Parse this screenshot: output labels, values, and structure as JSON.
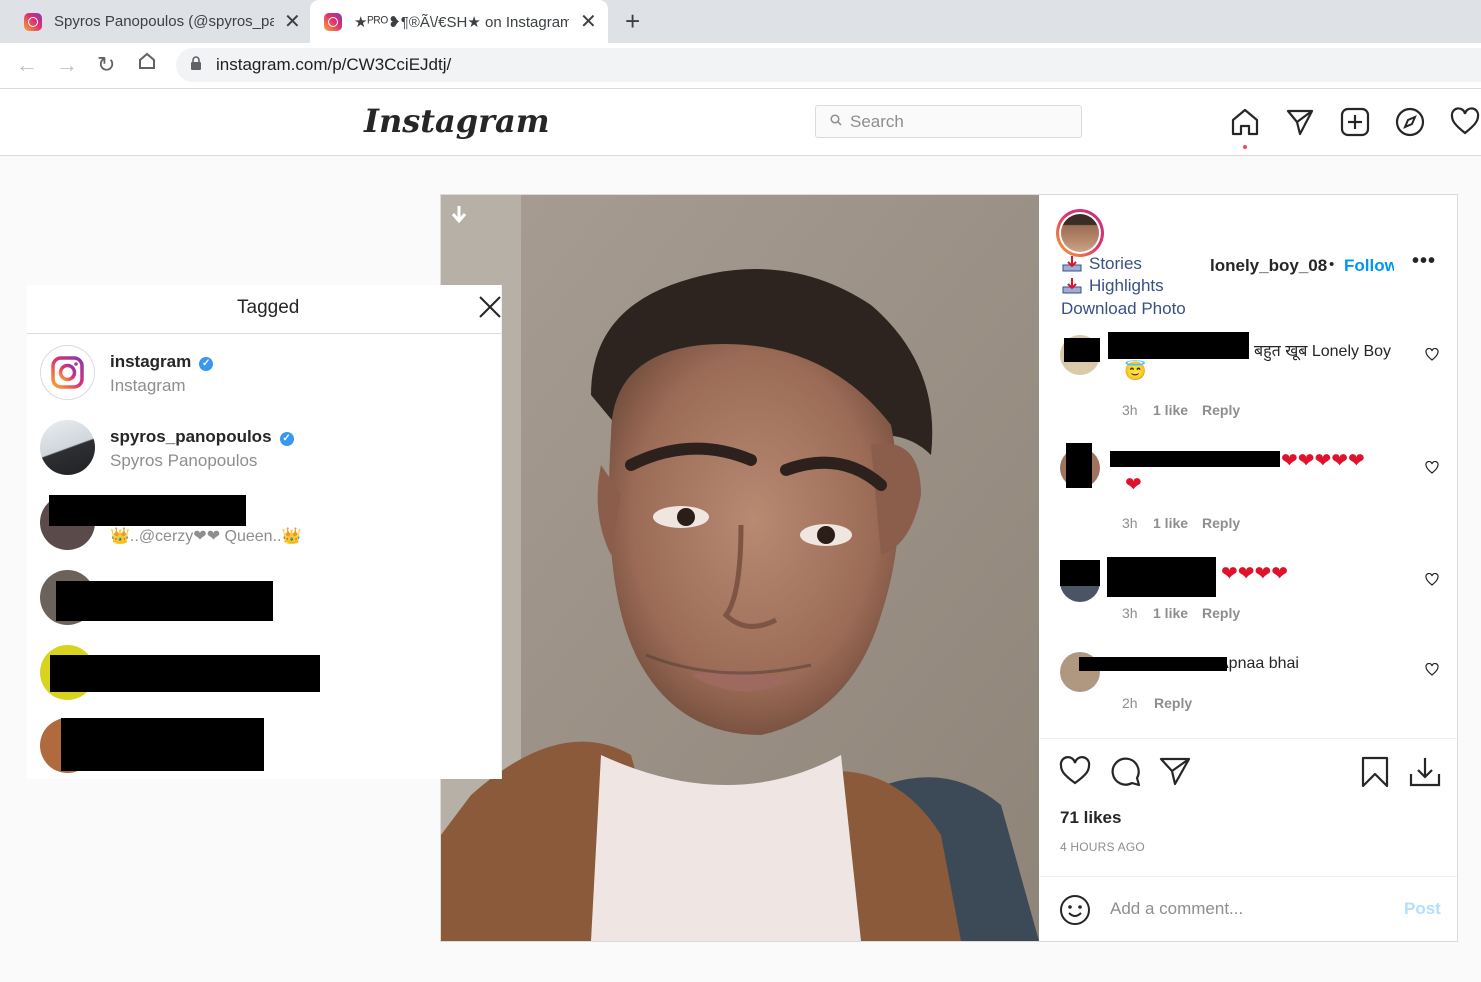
{
  "browser": {
    "tabs": [
      {
        "title": "Spyros Panopoulos (@spyros_panopoulos)"
      },
      {
        "title": "★ᴾᴿᴼ❥¶®Ã\\/€SH★ on Instagram: \""
      }
    ],
    "url": "instagram.com/p/CW3CciEJdtj/"
  },
  "header": {
    "logo": "Instagram",
    "search_placeholder": "Search"
  },
  "post": {
    "username": "lonely_boy_08",
    "separator": "•",
    "follow_label": "Follow",
    "more_label": "•••",
    "links": {
      "stories": "Stories",
      "highlights": "Highlights",
      "download": "Download Photo"
    },
    "comments": [
      {
        "text": "बहुत खूब Lonely Boy",
        "emoji": "😇",
        "time": "3h",
        "likes": "1 like",
        "reply": "Reply"
      },
      {
        "hearts_top": "❤❤❤❤❤",
        "hearts_bottom": "❤",
        "time": "3h",
        "likes": "1 like",
        "reply": "Reply"
      },
      {
        "hearts": "❤❤❤❤",
        "time": "3h",
        "likes": "1 like",
        "reply": "Reply"
      },
      {
        "text": "Apnaa bhai",
        "time": "2h",
        "reply": "Reply"
      }
    ],
    "likes": "71 likes",
    "time_ago": "4 HOURS AGO",
    "comment_placeholder": "Add a comment...",
    "post_label": "Post"
  },
  "tagged": {
    "title": "Tagged",
    "users": [
      {
        "name": "instagram",
        "subtitle": "Instagram",
        "verified": true
      },
      {
        "name": "spyros_panopoulos",
        "subtitle": "Spyros Panopoulos",
        "verified": true
      },
      {
        "subtitle": "👑..@cerzy❤❤ Queen..👑"
      }
    ]
  }
}
